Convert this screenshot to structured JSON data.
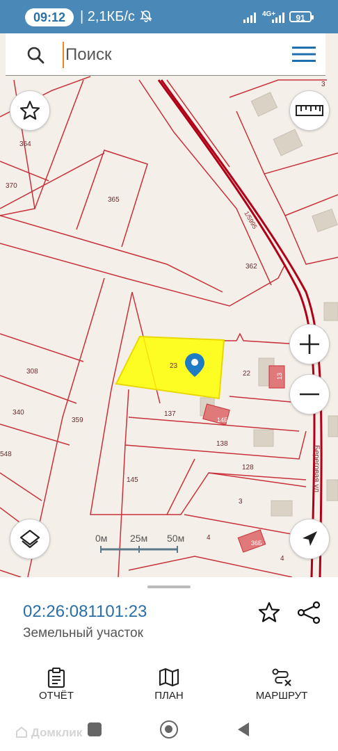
{
  "status_bar": {
    "time": "09:12",
    "network_speed": "| 2,1КБ/с",
    "signal_type": "4G+",
    "battery_level": "91"
  },
  "search": {
    "placeholder": "Поиск"
  },
  "map": {
    "parcel_labels": [
      "364",
      "370",
      "365",
      "362",
      "308",
      "340",
      "359",
      "23",
      "22",
      "137",
      "138",
      "128",
      "145",
      "3",
      "4",
      "4",
      "3",
      "548"
    ],
    "building_labels": [
      "14Б",
      "13",
      "36Б"
    ],
    "road_label": "Береговая ул",
    "scale": {
      "labels": [
        "0м",
        "25м",
        "50м"
      ]
    },
    "colors": {
      "parcel_boundary": "#c8303a",
      "selected_parcel": "#ffff00",
      "background": "#f4efe8",
      "building": "#d9d2c5",
      "highlight_building": "#e06a6a",
      "marker": "#1f7bc4"
    }
  },
  "parcel_card": {
    "cadastral_number": "02:26:081101:23",
    "type": "Земельный участок"
  },
  "bottom_tabs": [
    {
      "label": "ОТЧЁТ",
      "icon": "report-icon"
    },
    {
      "label": "ПЛАН",
      "icon": "map-icon"
    },
    {
      "label": "МАРШРУТ",
      "icon": "route-icon"
    }
  ],
  "nav": {
    "watermark": "Домклик"
  }
}
